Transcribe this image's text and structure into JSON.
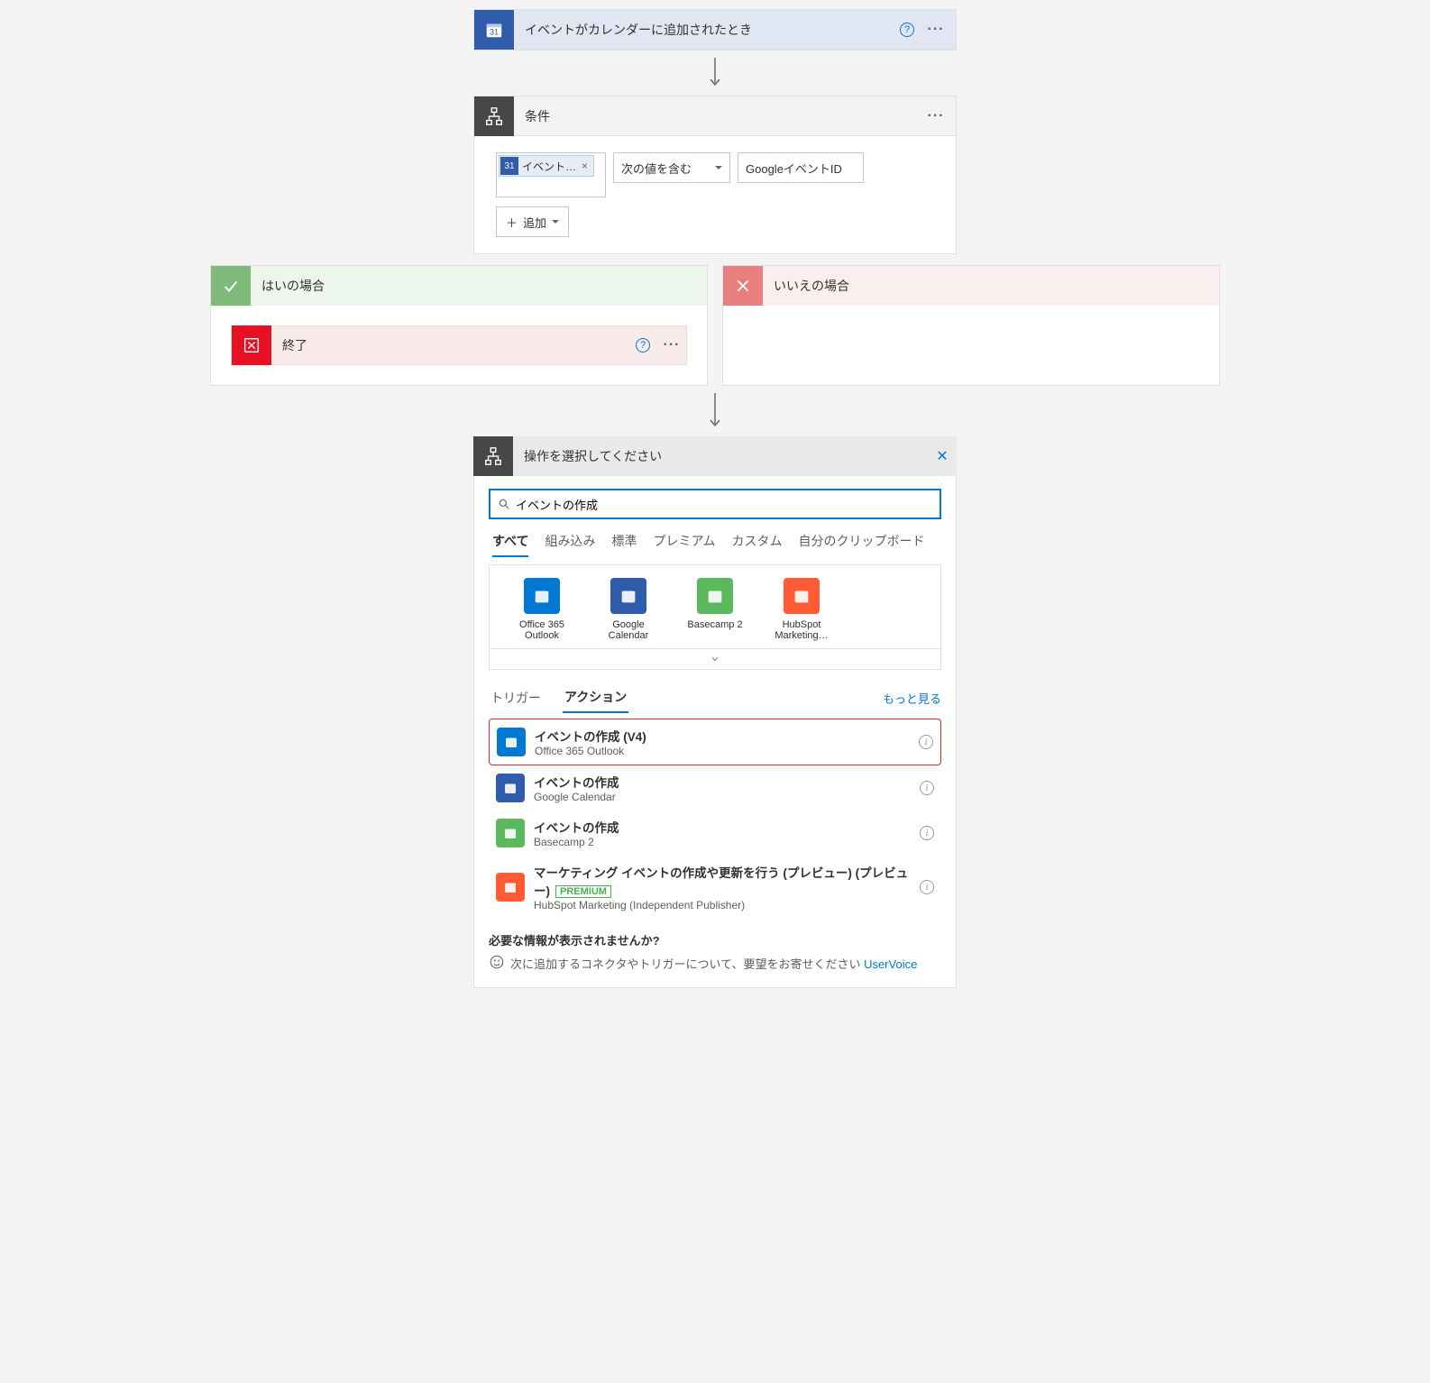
{
  "trigger": {
    "title": "イベントがカレンダーに追加されたとき"
  },
  "condition": {
    "title": "条件",
    "token_label": "イベント…",
    "operator": "次の値を含む",
    "value": "GoogleイベントID",
    "add_label": "追加"
  },
  "branches": {
    "yes": {
      "title": "はいの場合",
      "terminate_title": "終了"
    },
    "no": {
      "title": "いいえの場合"
    }
  },
  "picker": {
    "title": "操作を選択してください",
    "search_value": "イベントの作成",
    "tabs": [
      "すべて",
      "組み込み",
      "標準",
      "プレミアム",
      "カスタム",
      "自分のクリップボード"
    ],
    "active_tab": 0,
    "connectors": [
      {
        "name": "Office 365 Outlook",
        "color": "#0078d4"
      },
      {
        "name": "Google Calendar",
        "color": "#2f5cab"
      },
      {
        "name": "Basecamp 2",
        "color": "#5cb85c"
      },
      {
        "name": "HubSpot Marketing…",
        "color": "#ff5c35"
      }
    ],
    "subtabs": {
      "trigger": "トリガー",
      "action": "アクション",
      "more": "もっと見る"
    },
    "actions": [
      {
        "title": "イベントの作成 (V4)",
        "sub": "Office 365 Outlook",
        "color": "#0078d4",
        "highlight": true
      },
      {
        "title": "イベントの作成",
        "sub": "Google Calendar",
        "color": "#2f5cab"
      },
      {
        "title": "イベントの作成",
        "sub": "Basecamp 2",
        "color": "#5cb85c"
      },
      {
        "title": "マーケティング イベントの作成や更新を行う (プレビュー) (プレビュー)",
        "sub": "HubSpot Marketing (Independent Publisher)",
        "color": "#ff5c35",
        "premium": "PREMIUM"
      }
    ],
    "footer": {
      "q": "必要な情報が表示されませんか?",
      "text": "次に追加するコネクタやトリガーについて、要望をお寄せください ",
      "link": "UserVoice"
    }
  }
}
